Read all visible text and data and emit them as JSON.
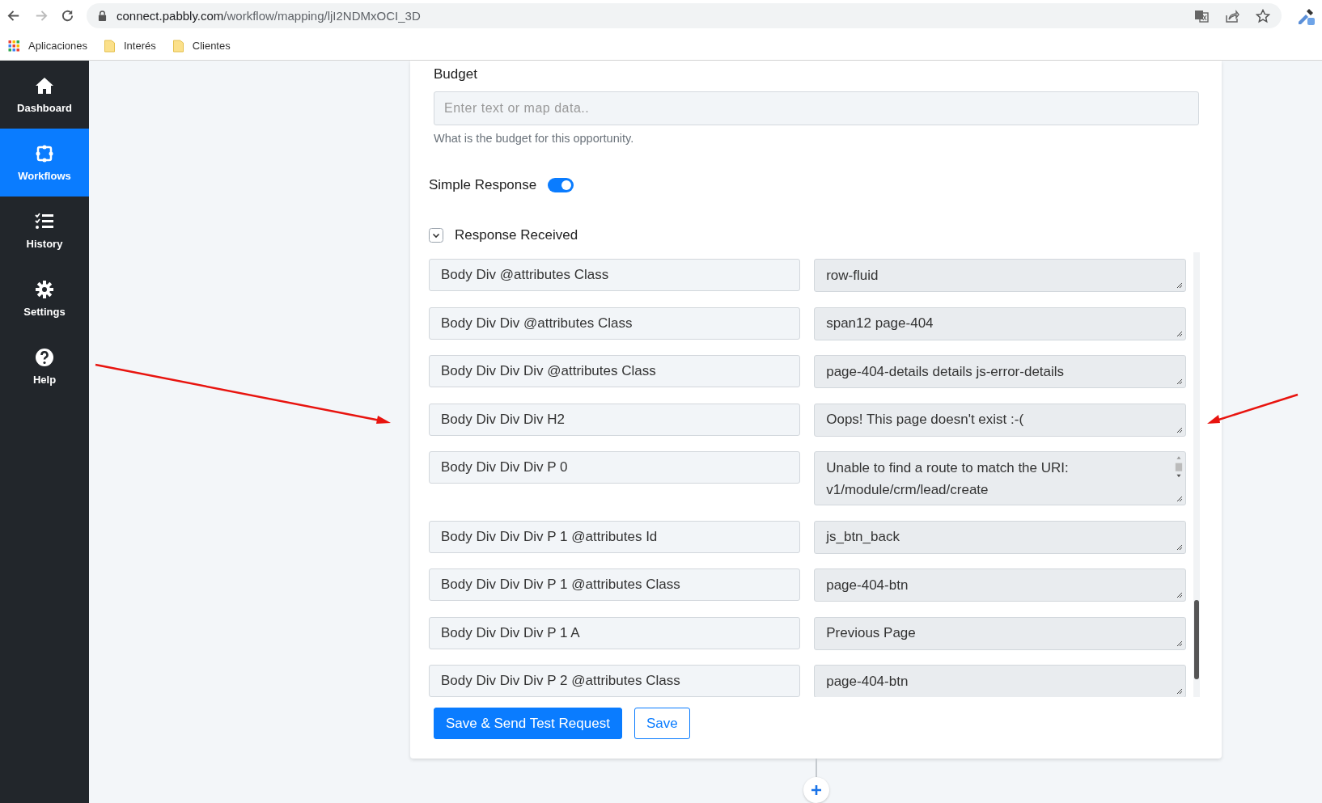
{
  "browser": {
    "url_host": "connect.pabbly.com",
    "url_path": "/workflow/mapping/ljI2NDMxOCI_3D",
    "forward_disabled": true,
    "bookmarks": [
      {
        "kind": "apps",
        "label": "Aplicaciones"
      },
      {
        "kind": "folder",
        "label": "Interés"
      },
      {
        "kind": "folder",
        "label": "Clientes"
      }
    ]
  },
  "sidebar": {
    "items": [
      {
        "kind": "home",
        "label": "Dashboard",
        "selected": false
      },
      {
        "kind": "workflow",
        "label": "Workflows",
        "selected": true
      },
      {
        "kind": "history",
        "label": "History",
        "selected": false
      },
      {
        "kind": "settings",
        "label": "Settings",
        "selected": false
      },
      {
        "kind": "help",
        "label": "Help",
        "selected": false
      }
    ]
  },
  "form": {
    "budget": {
      "label": "Budget",
      "placeholder": "Enter text or map data..",
      "help": "What is the budget for this opportunity."
    },
    "simple_response": {
      "label": "Simple Response",
      "on": true
    },
    "response_received": {
      "label": "Response Received",
      "expanded": true
    },
    "mappings": [
      {
        "key": "Body Div @attributes Class",
        "value": "row-fluid",
        "kind": "single"
      },
      {
        "key": "Body Div Div @attributes Class",
        "value": "span12 page-404",
        "kind": "single"
      },
      {
        "key": "Body Div Div Div @attributes Class",
        "value": "page-404-details details js-error-details",
        "kind": "single"
      },
      {
        "key": "Body Div Div Div H2",
        "value": "Oops! This page doesn't exist :-(",
        "kind": "single"
      },
      {
        "key": "Body Div Div Div P 0",
        "value": "Unable to find a route to match the URI: v1/module/crm/lead/create",
        "kind": "multiline"
      },
      {
        "key": "Body Div Div Div P 1 @attributes Id",
        "value": "js_btn_back",
        "kind": "single"
      },
      {
        "key": "Body Div Div Div P 1 @attributes Class",
        "value": "page-404-btn",
        "kind": "single"
      },
      {
        "key": "Body Div Div Div P 1 A",
        "value": "Previous Page",
        "kind": "single"
      },
      {
        "key": "Body Div Div Div P 2 @attributes Class",
        "value": "page-404-btn",
        "kind": "single"
      }
    ],
    "buttons": [
      {
        "kind": "primary",
        "label": "Save & Send Test Request"
      },
      {
        "kind": "outline",
        "label": "Save"
      }
    ]
  }
}
